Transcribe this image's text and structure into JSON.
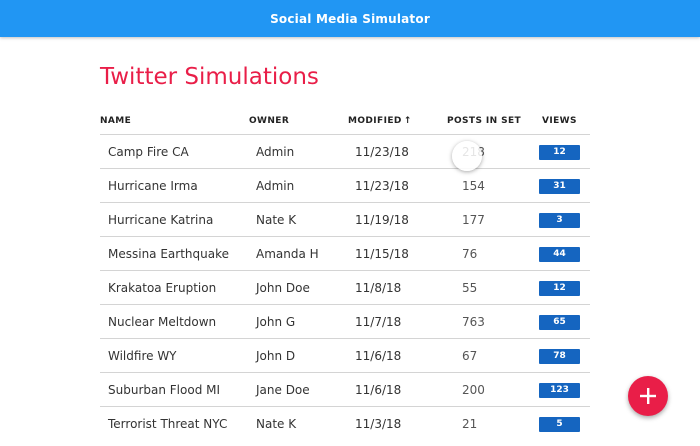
{
  "appbar": {
    "title": "Social Media Simulator"
  },
  "page": {
    "title": "Twitter Simulations"
  },
  "table": {
    "headers": {
      "name": "NAME",
      "owner": "OWNER",
      "modified": "MODIFIED",
      "modified_sort": "↑",
      "posts": "POSTS IN SET",
      "views": "VIEWS"
    },
    "rows": [
      {
        "name": "Camp Fire CA",
        "owner": "Admin",
        "modified": "11/23/18",
        "posts": "218",
        "views": "12"
      },
      {
        "name": "Hurricane Irma",
        "owner": "Admin",
        "modified": "11/23/18",
        "posts": "154",
        "views": "31"
      },
      {
        "name": "Hurricane Katrina",
        "owner": "Nate K",
        "modified": "11/19/18",
        "posts": "177",
        "views": "3"
      },
      {
        "name": "Messina Earthquake",
        "owner": "Amanda H",
        "modified": "11/15/18",
        "posts": "76",
        "views": "44"
      },
      {
        "name": "Krakatoa Eruption",
        "owner": "John Doe",
        "modified": "11/8/18",
        "posts": "55",
        "views": "12"
      },
      {
        "name": "Nuclear Meltdown",
        "owner": "John G",
        "modified": "11/7/18",
        "posts": "763",
        "views": "65"
      },
      {
        "name": "Wildfire WY",
        "owner": "John D",
        "modified": "11/6/18",
        "posts": "67",
        "views": "78"
      },
      {
        "name": "Suburban Flood MI",
        "owner": "Jane Doe",
        "modified": "11/6/18",
        "posts": "200",
        "views": "123"
      },
      {
        "name": "Terrorist Threat NYC",
        "owner": "Nate K",
        "modified": "11/3/18",
        "posts": "21",
        "views": "5"
      }
    ]
  },
  "fab": {
    "icon": "plus-icon"
  },
  "colors": {
    "appbar": "#2196f3",
    "title": "#e91e48",
    "badge": "#1565c0",
    "fab": "#e91e48"
  }
}
